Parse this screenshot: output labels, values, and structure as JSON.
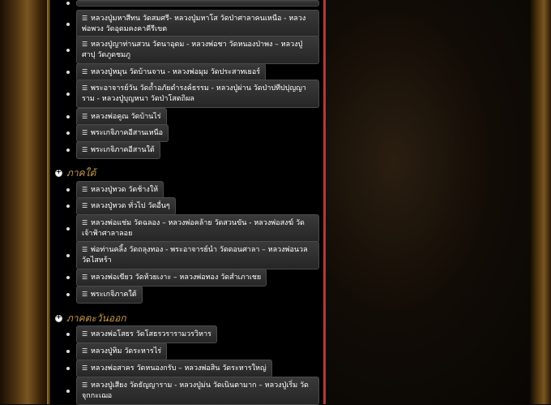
{
  "menu_top": [
    {
      "label": "หลวงปู่มหาสีทน วัดสมศรี- หลวงปู่มหาโส วัดป่าศาลาคนเหนือ - หลวงพ่อพวง วัดอุดมคงคาคีรีเขต"
    },
    {
      "label": "หลวงปู่ญาท่านสวน วัดนาอุดม - หลวงพ่อชา วัดหนองป่าพง – หลวงปู่ศาปุ วัดภูดชมภู"
    },
    {
      "label": "หลวงปู่หมุน วัดบ้านจาน - หลวงพ่อมุม วัดประสาทเยอร์"
    },
    {
      "label": "พระอาจารย์วัน วัดถ้ำอภัยดำรงค์ธรรม - หลวงปู่ผ่าน วัดป่าปทีปปุญญาราม - หลวงปู่บุญหนา วัดป่าโสตถิผล"
    },
    {
      "label": "หลวงพ่อคูณ วัดบ้านไร่"
    },
    {
      "label": "พระเกจิภาคอีสานเหนือ"
    },
    {
      "label": "พระเกจิภาคอีสานใต้"
    }
  ],
  "section_south": {
    "title": "ภาคใต้",
    "items": [
      {
        "label": "หลวงปู่ทวด วัดช้างให้"
      },
      {
        "label": "หลวงปู่ทวด ทั่วไป วัดอื่นๆ"
      },
      {
        "label": "หลวงพ่อแช่ม วัดฉลอง – หลวงพ่อคล้าย วัดสวนขัน - หลวงพ่อสงฆ์ วัดเจ้าฟ้าศาลาลอย"
      },
      {
        "label": "พ่อท่านคลิ้ง วัดถลุงทอง - พระอาจารย์นำ วัดดอนศาลา – หลวงพ่อนวล วัดไสหร้า"
      },
      {
        "label": "หลวงพ่อเขียว วัดห้วยเงาะ – หลวงพ่อทอง วัดสำเภาเชย"
      },
      {
        "label": "พระเกจิภาคใต้"
      }
    ]
  },
  "section_east": {
    "title": "ภาคตะวันออก",
    "items": [
      {
        "label": "หลวงพ่อโสธร วัดโสธรวรารามวรวิหาร"
      },
      {
        "label": "หลวงปู่ทิม วัดระหารไร่"
      },
      {
        "label": "หลวงพ่อสาคร วัดหนองกรับ – หลวงพ่อสิน วัดระหารใหญ่"
      },
      {
        "label": "หลวงปู่เสียง วัดธัญญาราม - หลวงปู่ม่น วัดเนินตามาก – หลวงปู่เริ่ม วัดจุกกะเฌอ"
      }
    ]
  },
  "colors": {
    "accent": "#c89a4a",
    "divider": "#b23a3a",
    "button_bg": "#2e2e2e"
  },
  "icons": {
    "list_icon": "list-icon",
    "section_icon": "plus-circle-icon"
  }
}
